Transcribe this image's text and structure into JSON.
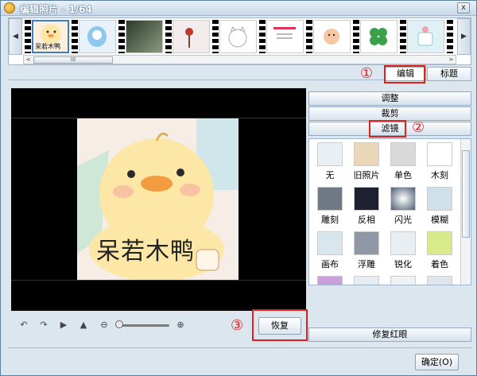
{
  "window": {
    "title": "编辑照片 - 1/64",
    "close_label": "x"
  },
  "filmstrip": {
    "left_arrow": "◀",
    "right_arrow": "▶",
    "scroll_left": "<",
    "scroll_right": ">",
    "scroll_grip": "III",
    "thumb_caption": "呆若木鸭"
  },
  "tabs": {
    "edit": "编辑",
    "title": "标题"
  },
  "preview": {
    "caption": "呆若木鸭"
  },
  "controls": {
    "restore_label": "恢复"
  },
  "panel": {
    "adjust": "调整",
    "crop": "裁剪",
    "filter": "滤镜",
    "filters": [
      {
        "label": "无"
      },
      {
        "label": "旧照片"
      },
      {
        "label": "单色"
      },
      {
        "label": "木刻"
      },
      {
        "label": "雕刻"
      },
      {
        "label": "反相"
      },
      {
        "label": "闪光"
      },
      {
        "label": "模糊"
      },
      {
        "label": "画布"
      },
      {
        "label": "浮雕"
      },
      {
        "label": "锐化"
      },
      {
        "label": "着色"
      },
      {
        "label": ""
      },
      {
        "label": ""
      },
      {
        "label": ""
      },
      {
        "label": ""
      }
    ],
    "repair_label": "修复红眼"
  },
  "footer": {
    "ok_label": "确定(O)"
  },
  "annotations": {
    "one": "①",
    "two": "②",
    "three": "③"
  },
  "colors": {
    "accent_red": "#e0201c",
    "window_bg": "#dce6ef"
  }
}
